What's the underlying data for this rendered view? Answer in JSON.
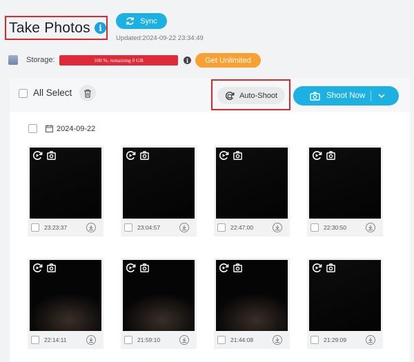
{
  "header": {
    "title": "Take Photos",
    "info_icon_glyph": "i",
    "sync_label": "Sync",
    "updated": "Updated:2024-09-22 23:34:49"
  },
  "storage": {
    "label": "Storage:",
    "bar_text": "100 %, remaining 0 GB",
    "used_fraction": 1.0,
    "info_glyph": "i",
    "get_unlimited_label": "Get Unlimited"
  },
  "toolbar": {
    "select_all_label": "All Select",
    "auto_shoot_label": "Auto-Shoot",
    "shoot_now_label": "Shoot Now"
  },
  "group": {
    "date": "2024-09-22"
  },
  "photos": [
    {
      "time": "23:23:37",
      "scene": "dark"
    },
    {
      "time": "23:04:57",
      "scene": "dark"
    },
    {
      "time": "22:47:00",
      "scene": "dark"
    },
    {
      "time": "22:30:50",
      "scene": "dark"
    },
    {
      "time": "22:14:11",
      "scene": "face"
    },
    {
      "time": "21:59:10",
      "scene": "face"
    },
    {
      "time": "21:44:08",
      "scene": "face"
    },
    {
      "time": "21:29:09",
      "scene": "dark"
    }
  ],
  "colors": {
    "accent": "#1cb0e3",
    "storage_fill": "#df2a3a",
    "get_unlimited": "#f9a030",
    "highlight_box": "#e0262b"
  }
}
